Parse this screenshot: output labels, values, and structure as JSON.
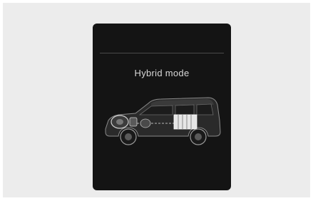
{
  "display": {
    "mode_label": "Hybrid mode"
  },
  "icons": {
    "vehicle": "suv-cutaway-icon",
    "engine": "engine-icon",
    "battery": "battery-pack-icon"
  },
  "colors": {
    "background": "#ececec",
    "screen": "#141414",
    "text": "#d8d8d8"
  }
}
